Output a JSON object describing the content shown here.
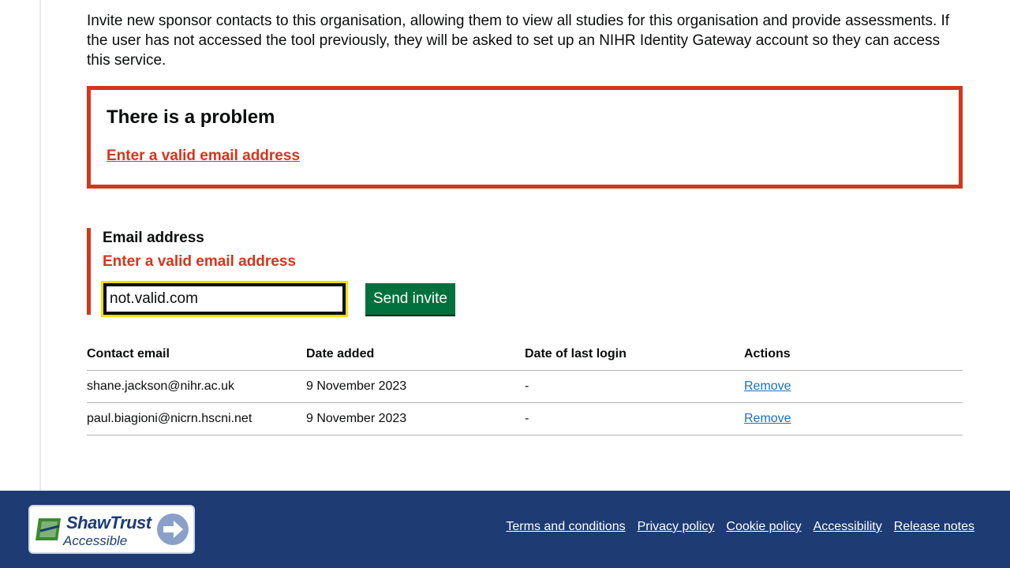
{
  "intro": "Invite new sponsor contacts to this organisation, allowing them to view all studies for this organisation and provide assessments. If the user has not accessed the tool previously, they will be asked to set up an NIHR Identity Gateway account so they can access this service.",
  "error_summary": {
    "title": "There is a problem",
    "link": "Enter a valid email address"
  },
  "form": {
    "label": "Email address",
    "error": "Enter a valid email address",
    "value": "not.valid.com",
    "submit": "Send invite"
  },
  "table": {
    "headers": [
      "Contact email",
      "Date added",
      "Date of last login",
      "Actions"
    ],
    "rows": [
      {
        "email": "shane.jackson@nihr.ac.uk",
        "date_added": "9 November 2023",
        "last_login": "-",
        "action": "Remove"
      },
      {
        "email": "paul.biagioni@nicrn.hscni.net",
        "date_added": "9 November 2023",
        "last_login": "-",
        "action": "Remove"
      }
    ]
  },
  "footer": {
    "badge_title": "ShawTrust",
    "badge_sub": "Accessible",
    "links": [
      "Terms and conditions",
      "Privacy policy",
      "Cookie policy",
      "Accessibility",
      "Release notes"
    ]
  },
  "colors": {
    "error": "#d4351c",
    "focus": "#ffdd00",
    "button": "#00703c",
    "link": "#1d70b8",
    "footer": "#1e3c73"
  }
}
